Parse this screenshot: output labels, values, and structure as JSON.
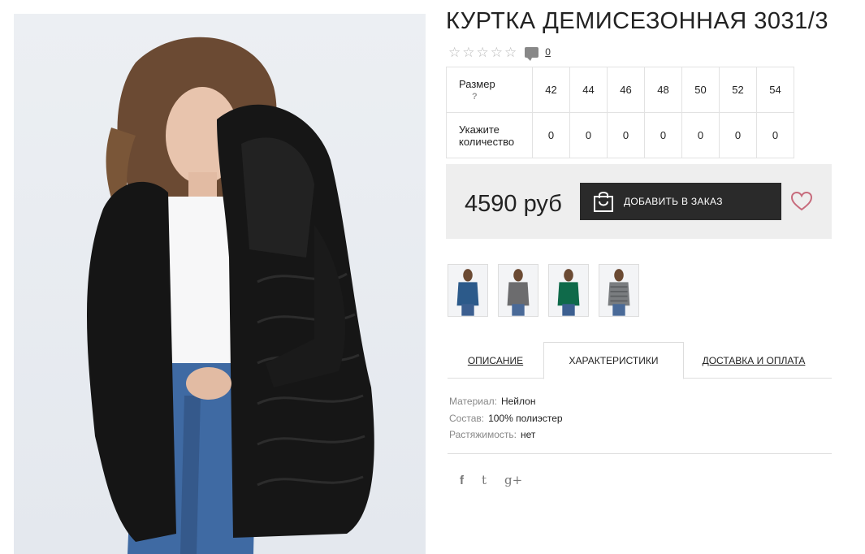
{
  "product": {
    "title": "КУРТКА ДЕМИСЕЗОННАЯ 3031/3",
    "stars": [
      "☆",
      "☆",
      "☆",
      "☆",
      "☆"
    ],
    "comment_icon": "comment-icon",
    "comment_count": "0"
  },
  "sizes": {
    "size_label": "Размер",
    "help_mark": "?",
    "qty_label": "Укажите количество",
    "values": [
      "42",
      "44",
      "46",
      "48",
      "50",
      "52",
      "54"
    ],
    "quantities": [
      "0",
      "0",
      "0",
      "0",
      "0",
      "0",
      "0"
    ]
  },
  "price": {
    "amount": "4590 руб",
    "cart_button": "ДОБАВИТЬ В ЗАКАЗ",
    "cart_icon": "shopping-bag-icon",
    "favorite_icon": "heart-icon",
    "accent_color": "#c76b7c"
  },
  "thumbnails": [
    {
      "alt": "jacket-blue"
    },
    {
      "alt": "jacket-grey"
    },
    {
      "alt": "jacket-green"
    },
    {
      "alt": "jacket-grey-print"
    }
  ],
  "tabs": {
    "description": "ОПИСАНИЕ",
    "characteristics": "ХАРАКТЕРИСТИКИ",
    "delivery": "ДОСТАВКА И ОПЛАТА",
    "active": "characteristics"
  },
  "specs": [
    {
      "key": "Материал:",
      "value": "Нейлон"
    },
    {
      "key": "Состав:",
      "value": "100% полиэстер"
    },
    {
      "key": "Растяжимость:",
      "value": "нет"
    }
  ],
  "social": {
    "facebook": "f",
    "twitter": "t",
    "google": "g+"
  }
}
